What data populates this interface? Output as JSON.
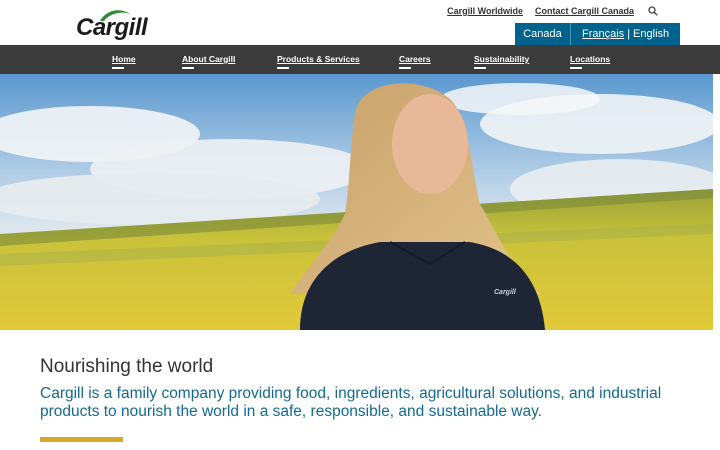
{
  "brand": {
    "logo_text": "Cargill"
  },
  "utility_nav": {
    "links": [
      "Cargill Worldwide",
      "Contact Cargill Canada"
    ]
  },
  "language": {
    "country": "Canada",
    "francais": "Français",
    "separator": "|",
    "english": "English"
  },
  "main_nav": [
    "Home",
    "About Cargill",
    "Products & Services",
    "Careers",
    "Sustainability",
    "Locations"
  ],
  "hero": {
    "logo_on_shirt": "Cargill"
  },
  "content": {
    "headline": "Nourishing the world",
    "tagline": "Cargill is a family company providing food, ingredients, agricultural solutions, and industrial products to nourish the world in a safe, responsible, and sustainable way."
  },
  "colors": {
    "nav_bg": "#3b3b3b",
    "lang_bg": "#00628d",
    "tagline": "#136a93",
    "accent": "#d6a82a"
  }
}
